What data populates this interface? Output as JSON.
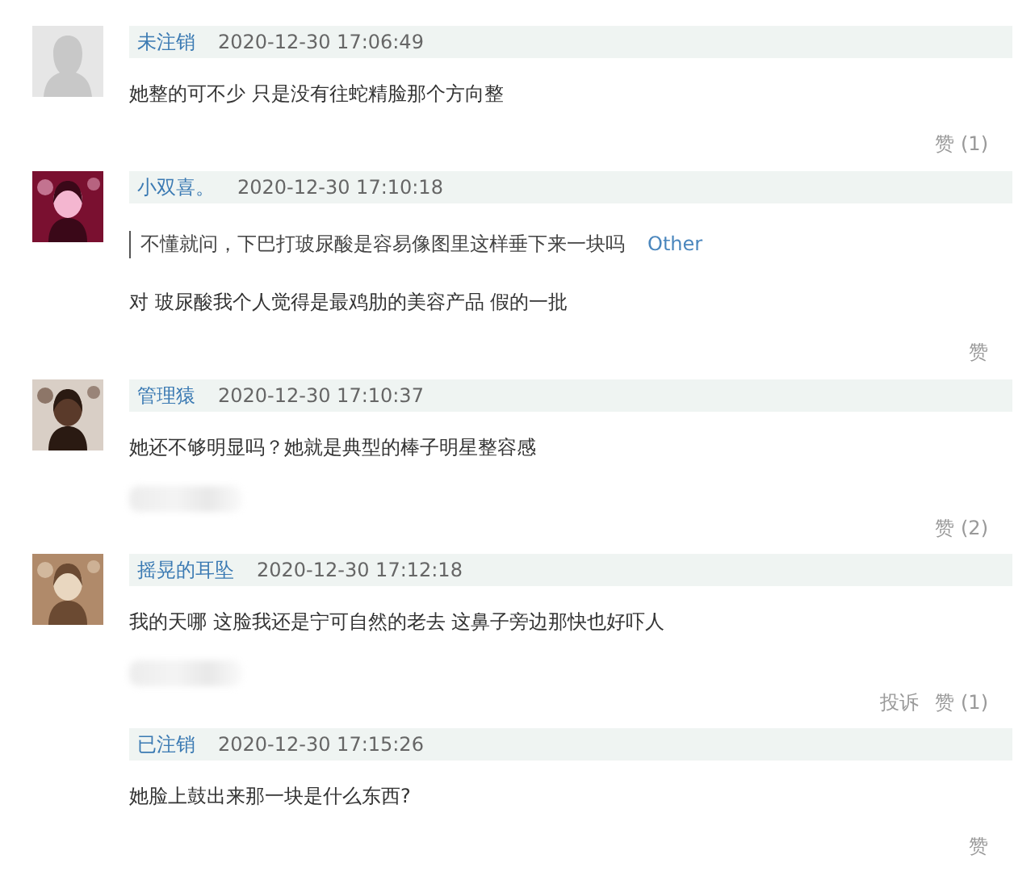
{
  "comments": [
    {
      "avatar": {
        "kind": "default"
      },
      "author": "未注销",
      "time": "2020-12-30 17:06:49",
      "text": "她整的可不少 只是没有往蛇精脸那个方向整",
      "footer": {
        "like": "赞 (1)"
      }
    },
    {
      "author": "小双喜。",
      "time": "2020-12-30 17:10:18",
      "quote": {
        "text": "不懂就问，下巴打玻尿酸是容易像图里这样垂下来一块吗",
        "source": "Other"
      },
      "text": "对 玻尿酸我个人觉得是最鸡肋的美容产品 假的一批",
      "footer": {
        "like": "赞"
      }
    },
    {
      "author": "管理猿",
      "time": "2020-12-30 17:10:37",
      "text": "她还不够明显吗？她就是典型的棒子明星整容感",
      "footer": {
        "redacted": true,
        "like": "赞 (2)"
      }
    },
    {
      "author": "摇晃的耳坠",
      "time": "2020-12-30 17:12:18",
      "text": "我的天哪 这脸我还是宁可自然的老去 这鼻子旁边那快也好吓人",
      "footer": {
        "redacted": true,
        "report": "投诉",
        "like": "赞 (1)"
      }
    },
    {
      "author": "已注销",
      "time": "2020-12-30 17:15:26",
      "text": "她脸上鼓出来那一块是什么东西?",
      "footer": {
        "like": "赞"
      }
    }
  ]
}
